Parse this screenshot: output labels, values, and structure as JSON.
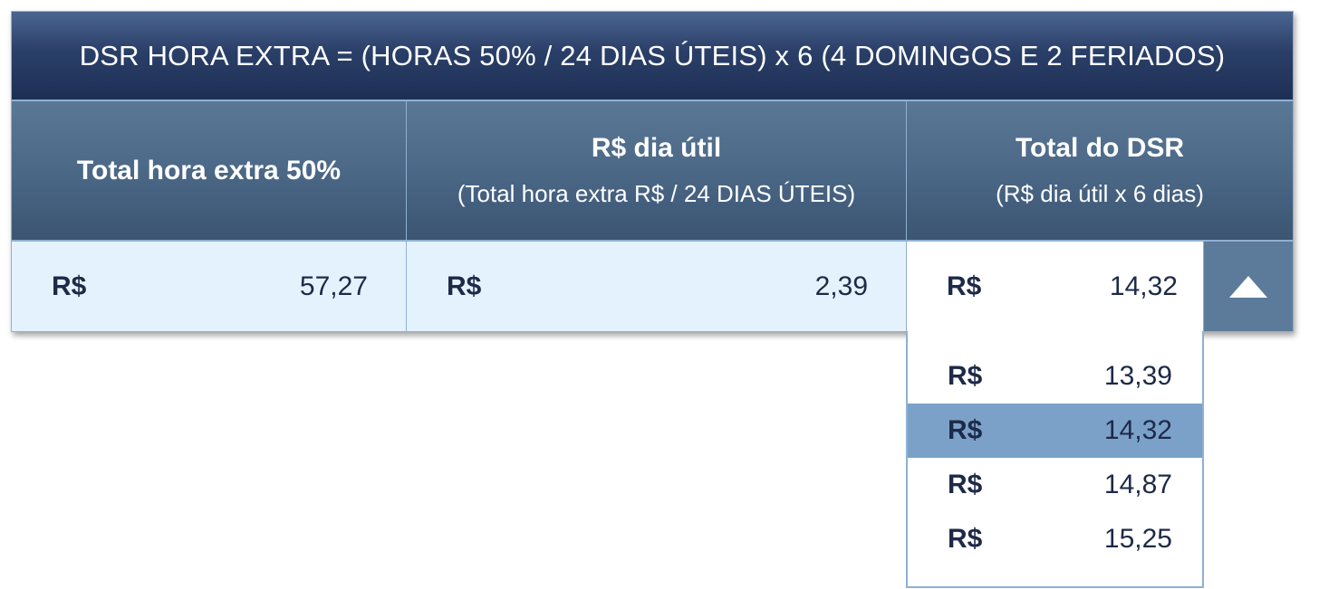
{
  "title": "DSR HORA EXTRA = (HORAS 50% / 24 DIAS ÚTEIS) x 6 (4 DOMINGOS E 2 FERIADOS)",
  "columns": [
    {
      "label": "Total hora extra 50%",
      "sublabel": ""
    },
    {
      "label": "R$ dia útil",
      "sublabel": "(Total hora extra R$ / 24 DIAS ÚTEIS)"
    },
    {
      "label": "Total do DSR",
      "sublabel": "(R$ dia útil x 6 dias)"
    }
  ],
  "values": [
    {
      "currency": "R$",
      "amount": "57,27"
    },
    {
      "currency": "R$",
      "amount": "2,39"
    },
    {
      "currency": "R$",
      "amount": "14,32"
    }
  ],
  "dropdown": {
    "toggle_icon": "triangle-up-icon",
    "options": [
      {
        "currency": "R$",
        "amount": "13,39"
      },
      {
        "currency": "R$",
        "amount": "14,32"
      },
      {
        "currency": "R$",
        "amount": "14,87"
      },
      {
        "currency": "R$",
        "amount": "15,25"
      }
    ],
    "selected_index": 1
  },
  "colors": {
    "title_bg": "#2a3f68",
    "header_bg": "#4d6a89",
    "value_bg": "#e4f2fd",
    "selected_option_bg": "#7ba1c9",
    "text_dark": "#1d2a48",
    "border": "#8fb0d2"
  }
}
